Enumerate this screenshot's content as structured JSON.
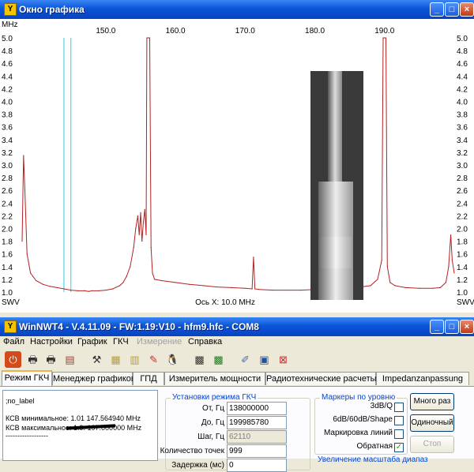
{
  "graph_window": {
    "title": "Окно графика",
    "y_unit": "MHz",
    "x_ticks": [
      "150.0",
      "160.0",
      "170.0",
      "180.0",
      "190.0"
    ],
    "y_ticks": [
      "5.0",
      "4.8",
      "4.6",
      "4.4",
      "4.2",
      "4.0",
      "3.8",
      "3.6",
      "3.4",
      "3.2",
      "3.0",
      "2.8",
      "2.6",
      "2.4",
      "2.2",
      "2.0",
      "1.8",
      "1.6",
      "1.4",
      "1.2",
      "1.0"
    ],
    "bottom_left": "SWV",
    "bottom_right": "SWV",
    "x_scale_label": "Ось X: 10.0 MHz",
    "trace_color": "#b22222",
    "marker_color": "#38c8e0"
  },
  "chart_data": {
    "type": "line",
    "xlim": [
      138.0,
      200.0
    ],
    "ylim": [
      1.0,
      5.0
    ],
    "series": [
      {
        "x": [
          138.0,
          138.2,
          138.4,
          138.7,
          139.2,
          140,
          141,
          142,
          143,
          144,
          145,
          146,
          147,
          147.56,
          148,
          149,
          150,
          151,
          152,
          152.5,
          153,
          153.5,
          154,
          154.3,
          154.6,
          154.8,
          155.0,
          155.2,
          155.4,
          155.6,
          155.8,
          155.9,
          156.1,
          156.3,
          156.5,
          156.7,
          157,
          158,
          160,
          162,
          164,
          166,
          168,
          170,
          171,
          171.2,
          171.4,
          172,
          174,
          176,
          178,
          180,
          182,
          184,
          186,
          188,
          189,
          189.6,
          189.8,
          190.0,
          190.2,
          190.4,
          190.8,
          191.5,
          193,
          195,
          197,
          198,
          198.8,
          199.2,
          199.5,
          199.7,
          200.0
        ],
        "y": [
          1.8,
          3.15,
          2.6,
          1.6,
          1.3,
          1.18,
          1.12,
          1.09,
          1.07,
          1.05,
          1.03,
          1.02,
          1.02,
          1.01,
          1.02,
          1.02,
          1.03,
          1.05,
          1.1,
          1.15,
          1.25,
          1.4,
          1.7,
          2.0,
          2.2,
          1.9,
          2.25,
          1.8,
          2.1,
          2.3,
          1.9,
          5.0,
          5.0,
          5.0,
          1.7,
          1.3,
          1.2,
          1.18,
          1.15,
          1.12,
          1.1,
          1.08,
          1.07,
          1.06,
          1.05,
          1.55,
          1.05,
          1.04,
          1.03,
          1.03,
          1.03,
          1.04,
          1.04,
          1.05,
          1.07,
          1.1,
          1.2,
          1.5,
          5.0,
          5.0,
          5.0,
          1.4,
          1.15,
          1.1,
          1.07,
          1.06,
          1.06,
          1.07,
          1.15,
          1.4,
          1.9,
          1.5,
          1.3
        ]
      }
    ],
    "markers_x": [
      144.0,
      145.0
    ]
  },
  "main_window": {
    "title": "WinNWT4 - V.4.11.09 - FW:1.19:V10 - hfm9.hfc - COM8",
    "menu": [
      "Файл",
      "Настройки",
      "График",
      "ГКЧ",
      "Измерение",
      "Справка"
    ],
    "menu_disabled": "Измерение",
    "tabs": [
      "Режим ГКЧ",
      "Менеджер графиков",
      "ГПД",
      "Измеритель мощности",
      "Радиотехнические расчеты",
      "Impedanzanpassung"
    ],
    "log": {
      "line1": ";no_label",
      "line2": "КСВ минимальное: 1.01  147.564940 MHz",
      "line3": "КСВ максимальное:  1.9.  197.000000 MHz",
      "line4": "------------------"
    },
    "sweep_group": {
      "title": "Установки режима ГКЧ",
      "from_label": "От, Гц",
      "from_value": "138000000",
      "to_label": "До, Гц",
      "to_value": "199985780",
      "step_label": "Шаг, Гц",
      "step_value": "62110",
      "points_label": "Количество точек",
      "points_value": "999",
      "delay_label": "Задержка (мс)",
      "delay_value": "0"
    },
    "markers_group": {
      "title": "Маркеры по уровню",
      "opt1": "3dB/Q",
      "opt2": "6dB/60dB/Shape",
      "opt3": "Маркировка линий",
      "opt4": "Обратная"
    },
    "buttons": {
      "multi": "Много раз",
      "single": "Одиночный",
      "stop": "Стоп"
    },
    "bottom_cut_text": "Увеличение масштаба диапаз"
  }
}
